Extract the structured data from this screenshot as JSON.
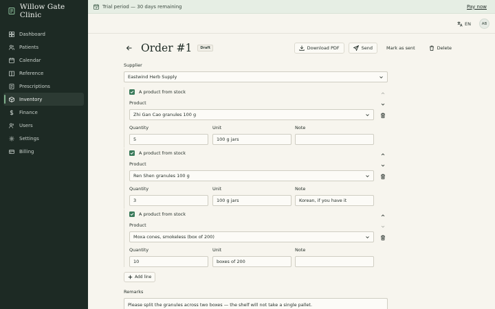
{
  "app": {
    "name": "Willow Gate Clinic"
  },
  "sidebar": {
    "items": [
      {
        "label": "Dashboard",
        "icon": "grid-icon"
      },
      {
        "label": "Patients",
        "icon": "users-icon"
      },
      {
        "label": "Calendar",
        "icon": "calendar-icon"
      },
      {
        "label": "Reference",
        "icon": "book-icon"
      },
      {
        "label": "Prescriptions",
        "icon": "prescription-icon"
      },
      {
        "label": "Inventory",
        "icon": "box-icon",
        "active": true
      },
      {
        "label": "Finance",
        "icon": "dollar-icon"
      },
      {
        "label": "Users",
        "icon": "user-group-icon"
      },
      {
        "label": "Settings",
        "icon": "gear-icon"
      },
      {
        "label": "Billing",
        "icon": "card-icon"
      }
    ]
  },
  "banner": {
    "text": "Trial period — 30 days remaining",
    "action": "Pay now"
  },
  "topbar": {
    "language": "EN",
    "avatar_initials": "AB"
  },
  "header": {
    "title": "Order #1",
    "status_badge": "Draft",
    "actions": {
      "download": "Download PDF",
      "send": "Send",
      "mark_sent": "Mark as sent",
      "delete": "Delete"
    }
  },
  "form": {
    "supplier_label": "Supplier",
    "supplier_value": "Eastwind Herb Supply",
    "lines": [
      {
        "stock_label": "A product from stock",
        "product_label": "Product",
        "product": "Zhi Gan Cao granules 100 g",
        "quantity_label": "Quantity",
        "quantity": "5",
        "unit_label": "Unit",
        "unit": "100 g jars",
        "note_label": "Note",
        "note": ""
      },
      {
        "stock_label": "A product from stock",
        "product_label": "Product",
        "product": "Ren Shen granules 100 g",
        "quantity_label": "Quantity",
        "quantity": "3",
        "unit_label": "Unit",
        "unit": "100 g jars",
        "note_label": "Note",
        "note": "Korean, if you have it"
      },
      {
        "stock_label": "A product from stock",
        "product_label": "Product",
        "product": "Moxa cones, smokeless (box of 200)",
        "quantity_label": "Quantity",
        "quantity": "10",
        "unit_label": "Unit",
        "unit": "boxes of 200",
        "note_label": "Note",
        "note": ""
      }
    ],
    "add_line_label": "Add line",
    "remarks_label": "Remarks",
    "remarks_value": "Please split the granules across two boxes — the shelf will not take a single pallet."
  },
  "colors": {
    "sidebar_bg": "#1d2a24",
    "accent": "#3a7a5a",
    "banner_bg": "#e6eee4",
    "page_bg": "#f7f5ee"
  }
}
